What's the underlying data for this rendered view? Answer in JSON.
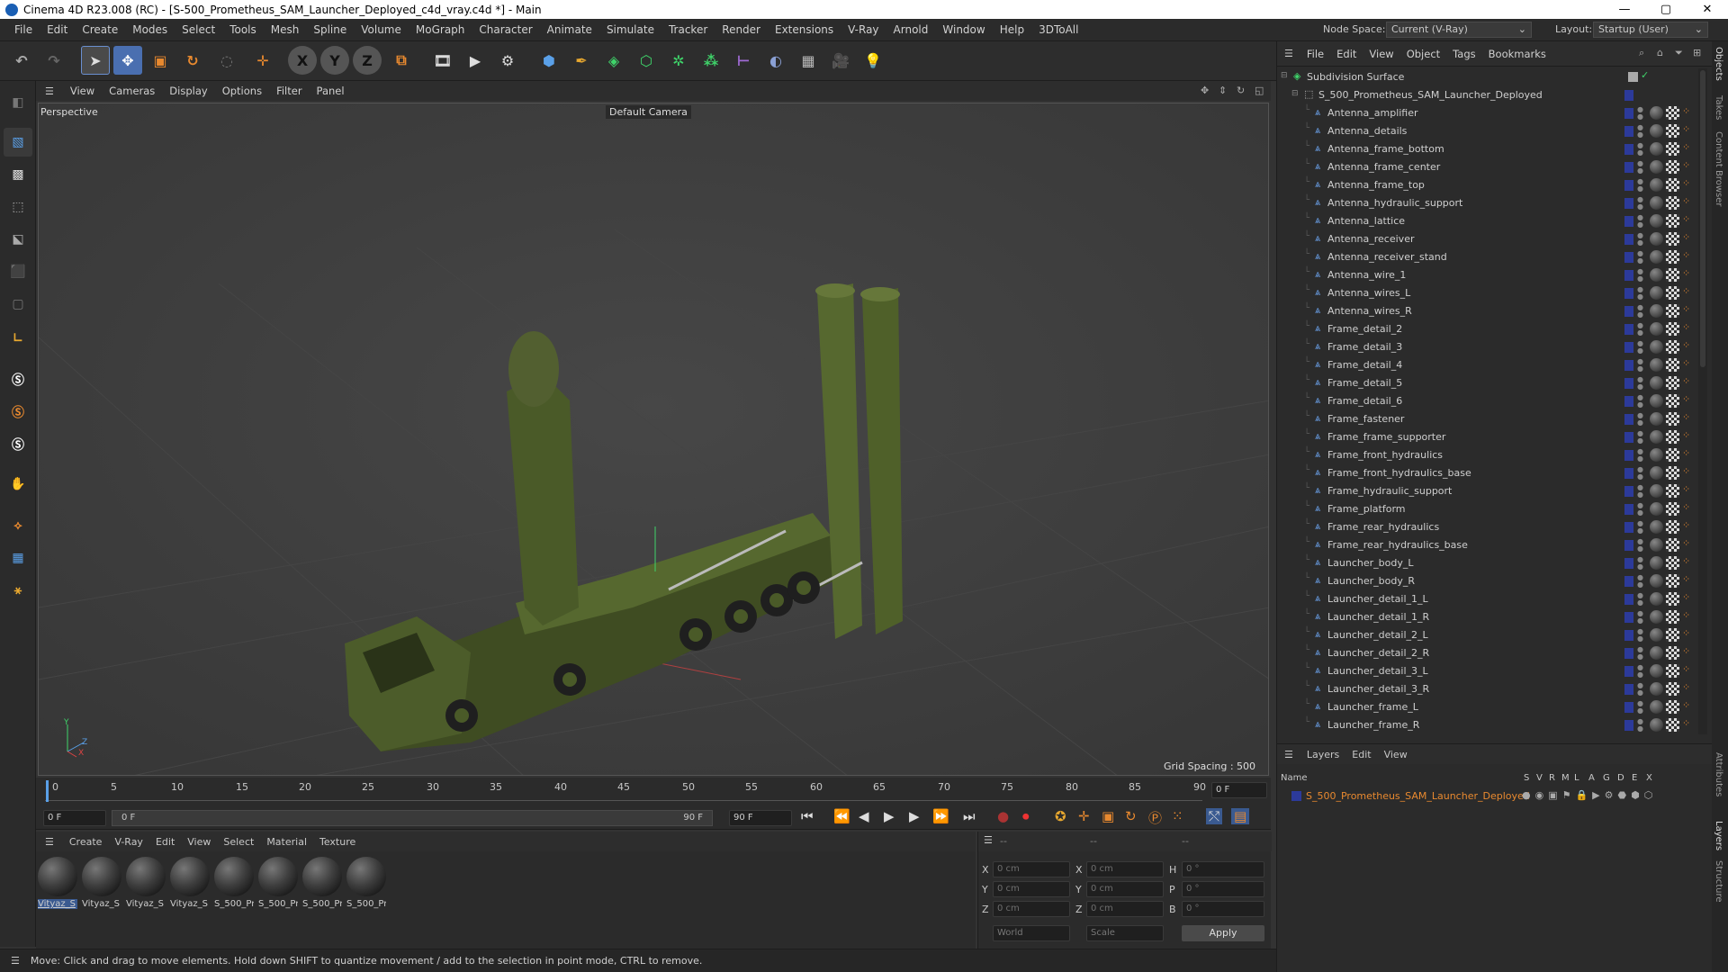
{
  "window": {
    "title": "Cinema 4D R23.008 (RC) - [S-500_Prometheus_SAM_Launcher_Deployed_c4d_vray.c4d *] - Main",
    "minimize": "—",
    "maximize": "▢",
    "close": "✕"
  },
  "menubar": {
    "items": [
      "File",
      "Edit",
      "Create",
      "Modes",
      "Select",
      "Tools",
      "Mesh",
      "Spline",
      "Volume",
      "MoGraph",
      "Character",
      "Animate",
      "Simulate",
      "Tracker",
      "Render",
      "Extensions",
      "V-Ray",
      "Arnold",
      "Window",
      "Help",
      "3DToAll"
    ],
    "node_space_label": "Node Space:",
    "node_space_value": "Current (V-Ray)",
    "layout_label": "Layout:",
    "layout_value": "Startup (User)"
  },
  "toolbar": {
    "axis_x": "X",
    "axis_y": "Y",
    "axis_z": "Z"
  },
  "viewport": {
    "menu": [
      "View",
      "Cameras",
      "Display",
      "Options",
      "Filter",
      "Panel"
    ],
    "label": "Perspective",
    "camera": "Default Camera",
    "grid_spacing": "Grid Spacing : 500 cm",
    "axis_x": "X",
    "axis_y": "Y",
    "axis_z": "Z"
  },
  "timeline": {
    "ticks": [
      "0",
      "5",
      "10",
      "15",
      "20",
      "25",
      "30",
      "35",
      "40",
      "45",
      "50",
      "55",
      "60",
      "65",
      "70",
      "75",
      "80",
      "85",
      "90"
    ],
    "current_frame": "0 F"
  },
  "tlcontrols": {
    "start": "0 F",
    "range_start": "0 F",
    "range_end": "90 F",
    "end": "90 F"
  },
  "materials": {
    "menu": [
      "Create",
      "V-Ray",
      "Edit",
      "View",
      "Select",
      "Material",
      "Texture"
    ],
    "items": [
      "Vityaz_S",
      "Vityaz_S",
      "Vityaz_S",
      "Vityaz_S",
      "S_500_Pr",
      "S_500_Pr",
      "S_500_Pr",
      "S_500_Pr"
    ]
  },
  "coords": {
    "headers": [
      "--",
      "--",
      "--"
    ],
    "rows": [
      {
        "a": "X",
        "av": "0 cm",
        "b": "X",
        "bv": "0 cm",
        "c": "H",
        "cv": "0 °"
      },
      {
        "a": "Y",
        "av": "0 cm",
        "b": "Y",
        "bv": "0 cm",
        "c": "P",
        "cv": "0 °"
      },
      {
        "a": "Z",
        "av": "0 cm",
        "b": "Z",
        "bv": "0 cm",
        "c": "B",
        "cv": "0 °"
      }
    ],
    "world": "World",
    "scale": "Scale",
    "apply": "Apply"
  },
  "status": "Move: Click and drag to move elements. Hold down SHIFT to quantize movement / add to the selection in point mode, CTRL to remove.",
  "objects": {
    "menu": [
      "File",
      "Edit",
      "View",
      "Object",
      "Tags",
      "Bookmarks"
    ],
    "root": "Subdivision Surface",
    "group": "S_500_Prometheus_SAM_Launcher_Deployed",
    "items": [
      "Antenna_amplifier",
      "Antenna_details",
      "Antenna_frame_bottom",
      "Antenna_frame_center",
      "Antenna_frame_top",
      "Antenna_hydraulic_support",
      "Antenna_lattice",
      "Antenna_receiver",
      "Antenna_receiver_stand",
      "Antenna_wire_1",
      "Antenna_wires_L",
      "Antenna_wires_R",
      "Frame_detail_2",
      "Frame_detail_3",
      "Frame_detail_4",
      "Frame_detail_5",
      "Frame_detail_6",
      "Frame_fastener",
      "Frame_frame_supporter",
      "Frame_front_hydraulics",
      "Frame_front_hydraulics_base",
      "Frame_hydraulic_support",
      "Frame_platform",
      "Frame_rear_hydraulics",
      "Frame_rear_hydraulics_base",
      "Launcher_body_L",
      "Launcher_body_R",
      "Launcher_detail_1_L",
      "Launcher_detail_1_R",
      "Launcher_detail_2_L",
      "Launcher_detail_2_R",
      "Launcher_detail_3_L",
      "Launcher_detail_3_R",
      "Launcher_frame_L",
      "Launcher_frame_R"
    ]
  },
  "layers": {
    "menu": [
      "Layers",
      "Edit",
      "View"
    ],
    "name_header": "Name",
    "cols": [
      "S",
      "V",
      "R",
      "M",
      "L",
      "A",
      "G",
      "D",
      "E",
      "X"
    ],
    "layer": "S_500_Prometheus_SAM_Launcher_Deployed"
  },
  "side_tabs": [
    "Objects",
    "Takes",
    "Content Browser",
    "Attributes",
    "Layers",
    "Structure"
  ],
  "colors": {
    "accent": "#4a7fd4",
    "layer_orange": "#e8892f",
    "vehicle_green": "#4a5a2a"
  }
}
